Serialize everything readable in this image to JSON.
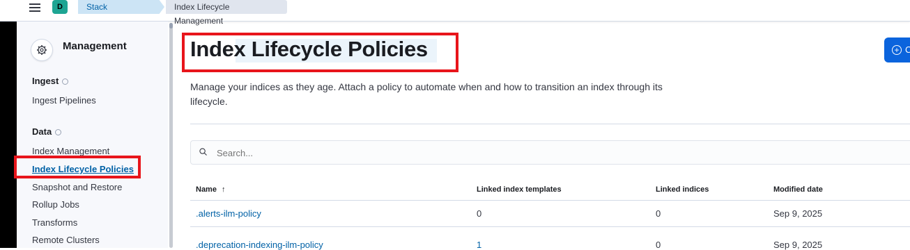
{
  "header": {
    "space_initial": "D",
    "breadcrumbs": [
      "Stack Management",
      "Index Lifecycle Management"
    ]
  },
  "sidebar": {
    "title": "Management",
    "sections": [
      {
        "label": "Ingest",
        "items": [
          "Ingest Pipelines"
        ]
      },
      {
        "label": "Data",
        "items": [
          "Index Management",
          "Index Lifecycle Policies",
          "Snapshot and Restore",
          "Rollup Jobs",
          "Transforms",
          "Remote Clusters"
        ]
      }
    ],
    "active_item": "Index Lifecycle Policies"
  },
  "main": {
    "title": "Index Lifecycle Policies",
    "description": "Manage your indices as they age. Attach a policy to automate when and how to transition an index through its lifecycle.",
    "create_button_label": "C",
    "search_placeholder": "Search..."
  },
  "table": {
    "columns": [
      "Name",
      "Linked index templates",
      "Linked indices",
      "Modified date"
    ],
    "rows": [
      {
        "name": ".alerts-ilm-policy",
        "templates": "0",
        "indices": "0",
        "modified": "Sep 9, 2025"
      },
      {
        "name": ".deprecation-indexing-ilm-policy",
        "templates": "1",
        "indices": "0",
        "modified": "Sep 9, 2025"
      }
    ]
  },
  "colors": {
    "accent": "#0061a6",
    "highlight": "#e8151b",
    "button": "#0b64dd"
  }
}
